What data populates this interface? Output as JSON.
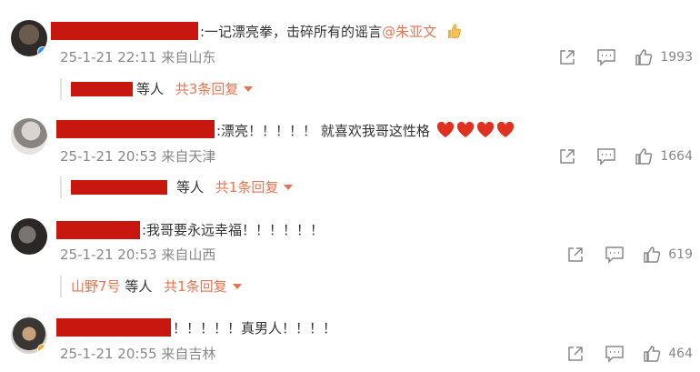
{
  "comments": [
    {
      "text": ":一记漂亮拳，击碎所有的谣言",
      "mention": "@朱亚文",
      "emoji": "thumbs-up-icon",
      "time": "25-1-21 22:11",
      "location": "来自山东",
      "likes": "1993",
      "reply": {
        "suffix": "等人",
        "count": "共3条回复"
      }
    },
    {
      "text": ":漂亮！！！！！ 就喜欢我哥这性格",
      "emoji": "heart-icon",
      "time": "25-1-21 20:53",
      "location": "来自天津",
      "likes": "1664",
      "reply": {
        "suffix": "等人",
        "count": "共1条回复"
      }
    },
    {
      "text": ":我哥要永远幸福！！！！！！",
      "time": "25-1-21 20:53",
      "location": "来自山西",
      "likes": "619",
      "reply": {
        "user": "山野7号",
        "suffix": "等人",
        "count": "共1条回复"
      }
    },
    {
      "text": "！！！！！真男人！！！！",
      "time": "25-1-21 20:55",
      "location": "来自吉林",
      "likes": "464"
    }
  ],
  "colors": {
    "accent": "#eb7350",
    "redaction": "#c8170e",
    "meta": "#888888",
    "heart": "#e0301e"
  }
}
